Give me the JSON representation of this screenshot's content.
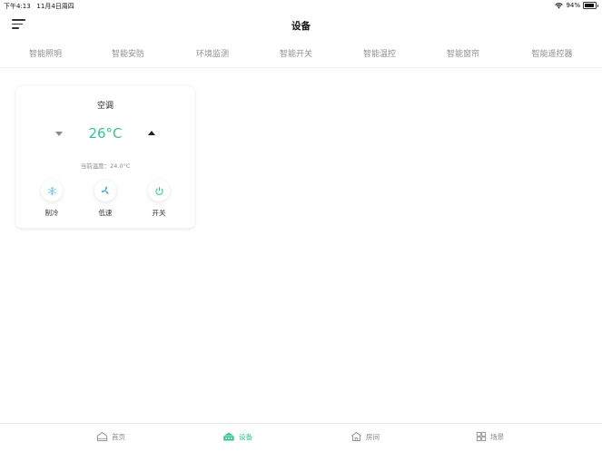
{
  "status_bar": {
    "time": "下午4:13",
    "date": "11月4日周四",
    "battery": "94%",
    "battery_fraction": 0.94
  },
  "header": {
    "title": "设备"
  },
  "tabs": [
    {
      "label": "智能照明",
      "active": false
    },
    {
      "label": "智能安防",
      "active": false
    },
    {
      "label": "环境监测",
      "active": false
    },
    {
      "label": "智能开关",
      "active": false
    },
    {
      "label": "智能温控",
      "active": true
    },
    {
      "label": "智能窗帘",
      "active": false
    },
    {
      "label": "智能遥控器",
      "active": false
    }
  ],
  "device_card": {
    "title": "空调",
    "set_temp": "26°C",
    "current_temp": "当前温度：24.0°C",
    "controls": [
      {
        "label": "制冷",
        "icon": "snowflake-icon"
      },
      {
        "label": "低速",
        "icon": "fan-icon"
      },
      {
        "label": "开关",
        "icon": "power-icon"
      }
    ]
  },
  "bottom_nav": [
    {
      "label": "首页",
      "icon": "home-icon",
      "active": false
    },
    {
      "label": "设备",
      "icon": "device-icon",
      "active": true
    },
    {
      "label": "房间",
      "icon": "room-icon",
      "active": false
    },
    {
      "label": "场景",
      "icon": "scene-icon",
      "active": false
    }
  ],
  "colors": {
    "accent": "#3bbf96",
    "inactive_text": "#8f8f8f"
  }
}
